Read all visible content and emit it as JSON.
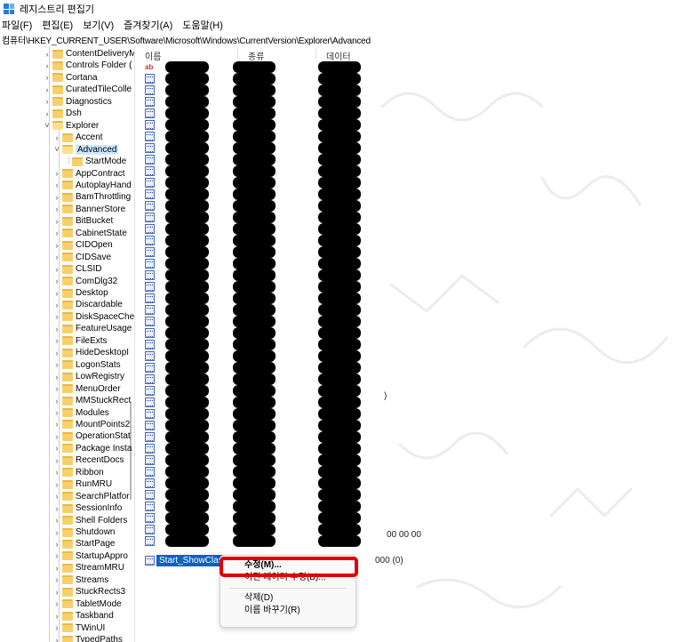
{
  "window": {
    "title": "레지스트리 편집기"
  },
  "menu": [
    "파일(F)",
    "편집(E)",
    "보기(V)",
    "즐겨찾기(A)",
    "도움말(H)"
  ],
  "address": "컴퓨터\\HKEY_CURRENT_USER\\Software\\Microsoft\\Windows\\CurrentVersion\\Explorer\\Advanced",
  "tree": {
    "items": [
      {
        "label": "ContentDeliveryM",
        "expanded": false
      },
      {
        "label": "Controls Folder (",
        "expanded": false
      },
      {
        "label": "Cortana",
        "expanded": false
      },
      {
        "label": "CuratedTileColle",
        "expanded": false
      },
      {
        "label": "Diagnostics",
        "expanded": false
      },
      {
        "label": "Dsh",
        "expanded": false
      },
      {
        "label": "Explorer",
        "expanded": true
      },
      {
        "label": "Accent",
        "expanded": false
      },
      {
        "label": "Advanced",
        "expanded": true,
        "selected": true
      },
      {
        "label": "StartMode",
        "expanded": false
      },
      {
        "label": "AppContract",
        "expanded": false
      },
      {
        "label": "AutoplayHand",
        "expanded": false
      },
      {
        "label": "BamThrottling",
        "expanded": false
      },
      {
        "label": "BannerStore",
        "expanded": false
      },
      {
        "label": "BitBucket",
        "expanded": false
      },
      {
        "label": "CabinetState",
        "expanded": false
      },
      {
        "label": "CIDOpen",
        "expanded": false
      },
      {
        "label": "CIDSave",
        "expanded": false
      },
      {
        "label": "CLSID",
        "expanded": false
      },
      {
        "label": "ComDlg32",
        "expanded": false
      },
      {
        "label": "Desktop",
        "expanded": false
      },
      {
        "label": "Discardable",
        "expanded": false
      },
      {
        "label": "DiskSpaceChe",
        "expanded": false
      },
      {
        "label": "FeatureUsage",
        "expanded": false
      },
      {
        "label": "FileExts",
        "expanded": false
      },
      {
        "label": "HideDesktopI",
        "expanded": false
      },
      {
        "label": "LogonStats",
        "expanded": false
      },
      {
        "label": "LowRegistry",
        "expanded": false
      },
      {
        "label": "MenuOrder",
        "expanded": false
      },
      {
        "label": "MMStuckRect",
        "expanded": false
      },
      {
        "label": "Modules",
        "expanded": false
      },
      {
        "label": "MountPoints2",
        "expanded": false
      },
      {
        "label": "OperationStat",
        "expanded": false
      },
      {
        "label": "Package Insta",
        "expanded": false
      },
      {
        "label": "RecentDocs",
        "expanded": false
      },
      {
        "label": "Ribbon",
        "expanded": false
      },
      {
        "label": "RunMRU",
        "expanded": false
      },
      {
        "label": "SearchPlatfor",
        "expanded": false
      },
      {
        "label": "SessionInfo",
        "expanded": false
      },
      {
        "label": "Shell Folders",
        "expanded": false
      },
      {
        "label": "Shutdown",
        "expanded": false
      },
      {
        "label": "StartPage",
        "expanded": false
      },
      {
        "label": "StartupAppro",
        "expanded": false
      },
      {
        "label": "StreamMRU",
        "expanded": false
      },
      {
        "label": "Streams",
        "expanded": false
      },
      {
        "label": "StuckRects3",
        "expanded": false
      },
      {
        "label": "TabletMode",
        "expanded": false
      },
      {
        "label": "Taskband",
        "expanded": false
      },
      {
        "label": "TWinUI",
        "expanded": false
      },
      {
        "label": "TypedPaths",
        "expanded": false
      }
    ]
  },
  "values": {
    "headers": {
      "name": "이름",
      "type": "종류",
      "data": "데이터"
    },
    "row_count": 42,
    "data_fragments": [
      ")",
      "00 00 00"
    ],
    "selected": {
      "name": "Start_ShowClassic",
      "data": "000 (0)"
    }
  },
  "context_menu": {
    "items": [
      {
        "label": "수정(M)...",
        "bold": true
      },
      {
        "label": "이진 데이터 수정(B)...",
        "bold": false
      },
      {
        "label": "삭제(D)",
        "bold": false
      },
      {
        "label": "이름 바꾸기(R)",
        "bold": false
      }
    ]
  },
  "colors": {
    "highlight": "#e00000",
    "selection": "#0b61c4",
    "folder": "#f7d06b"
  }
}
